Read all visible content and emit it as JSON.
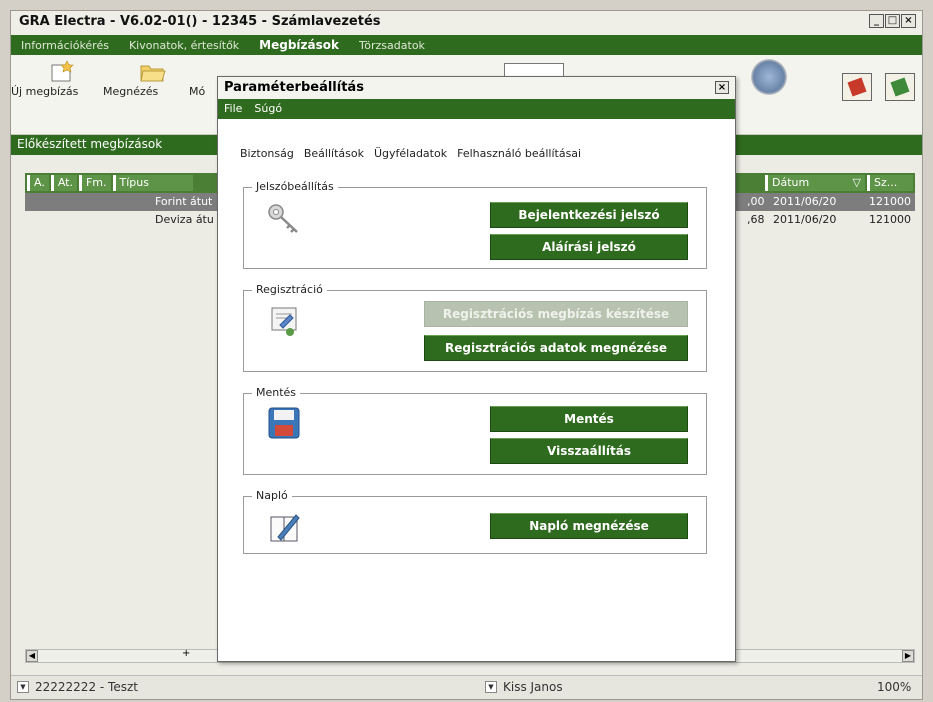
{
  "window": {
    "title": "GRA Electra - V6.02-01() - 12345 - Számlavezetés",
    "controls": [
      "_",
      "□",
      "×"
    ]
  },
  "menubar": {
    "items": [
      "Információkérés",
      "Kivonatok, értesítők",
      "Megbízások",
      "Törzsadatok"
    ],
    "active": "Megbízások"
  },
  "toolbar": {
    "new_label": "Új megbízás",
    "view_label": "Megnézés",
    "mod_label": "Mó"
  },
  "section": {
    "title": "Előkészített megbízások"
  },
  "grid": {
    "headers_left": [
      "A.",
      "At.",
      "Fm.",
      "Típus"
    ],
    "headers_right": [
      "Dátum",
      "Sz..."
    ],
    "sort_indicator": "▽",
    "rows": [
      {
        "type": "Forint átut",
        "amount_tail": ",00",
        "date": "2011/06/20",
        "sz": "121000"
      },
      {
        "type": "Deviza átu",
        "amount_tail": ",68",
        "date": "2011/06/20",
        "sz": "121000"
      }
    ]
  },
  "statusbar": {
    "account": "22222222 - Teszt",
    "user": "Kiss Janos",
    "zoom": "100%"
  },
  "dialog": {
    "title": "Paraméterbeállítás",
    "close": "×",
    "menu": [
      "File",
      "Súgó"
    ],
    "tabs": [
      "Biztonság",
      "Beállítások",
      "Ügyféladatok",
      "Felhasználó beállításai"
    ],
    "groups": {
      "password": {
        "legend": "Jelszóbeállítás",
        "login_btn": "Bejelentkezési jelszó",
        "sign_btn": "Aláírási jelszó"
      },
      "registration": {
        "legend": "Regisztráció",
        "create_btn": "Regisztrációs megbízás készítése",
        "view_btn": "Regisztrációs adatok megnézése"
      },
      "backup": {
        "legend": "Mentés",
        "save_btn": "Mentés",
        "restore_btn": "Visszaállítás"
      },
      "log": {
        "legend": "Napló",
        "view_btn": "Napló megnézése"
      }
    }
  }
}
